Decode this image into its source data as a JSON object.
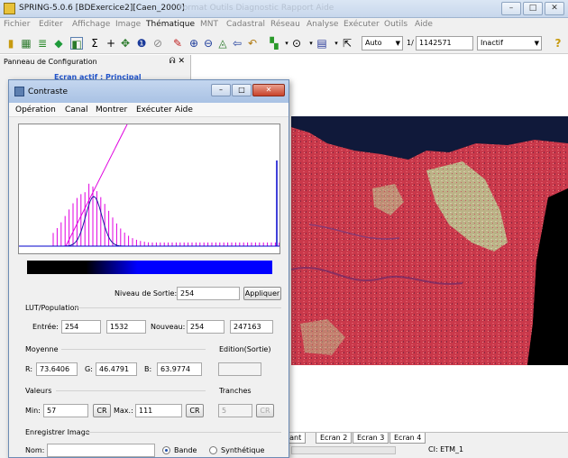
{
  "app": {
    "title": "SPRING-5.0.6 [BDExercice2][Caen_2000]",
    "ghost_title": "Format   Outils   Diagnostic   Rapport   Aide"
  },
  "menubar": [
    "Fichier",
    "Editer",
    "Affichage",
    "Image",
    "Thématique",
    "MNT",
    "Cadastral",
    "Réseau",
    "Analyse",
    "Exécuter",
    "Outils",
    "Aide"
  ],
  "toolbar": {
    "zoom_mode": "Auto",
    "scale_prefix": "1/",
    "scale_value": "1142571",
    "state": "Inactif"
  },
  "config_panel": {
    "title": "Panneau de Configuration",
    "active_screen": "Ecran actif : Principal"
  },
  "map": {
    "tabs": [
      "tant",
      "Ecran 2",
      "Ecran 3",
      "Ecran 4"
    ],
    "ci_label": "CI: ETM_1"
  },
  "dialog": {
    "title": "Contraste",
    "menu": [
      "Opération",
      "Canal",
      "Montrer",
      "Exécuter",
      "Aide"
    ],
    "output_level_label": "Niveau de Sortie:",
    "output_level_value": "254",
    "apply_button": "Appliquer",
    "lut_section": "LUT/Population",
    "entry_label": "Entrée:",
    "entry_value": "254",
    "entry_pop": "1532",
    "new_label": "Nouveau:",
    "new_value": "254",
    "new_pop": "247163",
    "mean_section": "Moyenne",
    "edition_section": "Edition(Sortie)",
    "r_label": "R:",
    "r_value": "73.6406",
    "g_label": "G:",
    "g_value": "46.4791",
    "b_label": "B:",
    "b_value": "63.9774",
    "values_section": "Valeurs",
    "slices_section": "Tranches",
    "min_label": "Min:",
    "min_value": "57",
    "cr_label": "CR",
    "max_label": "Max.:",
    "max_value": "111",
    "slices_value": "5",
    "save_section": "Enregistrer Image",
    "name_label": "Nom:",
    "name_value": "",
    "radio_band": "Bande",
    "radio_synth": "Synthétique"
  },
  "colors": {
    "histogram_lut": "#e000e0",
    "histogram_curve": "#1a1aa0",
    "image_red": "#c8343c"
  }
}
